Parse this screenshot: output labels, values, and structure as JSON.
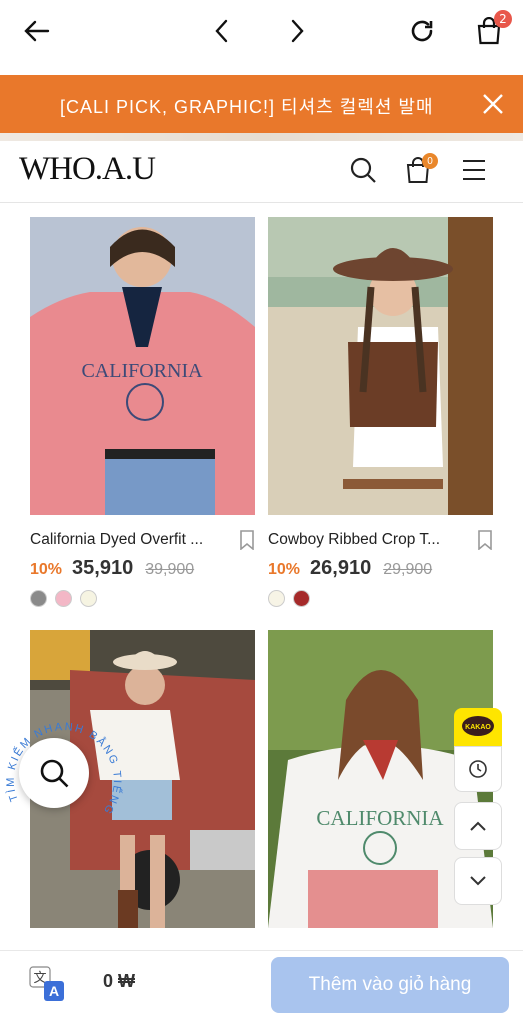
{
  "browser": {
    "cart_count": "2"
  },
  "promo": {
    "text": "[CALI PICK, GRAPHIC!] 티셔츠 컬렉션 발매"
  },
  "header": {
    "logo": "WHO.A.U",
    "cart_count": "0"
  },
  "products": [
    {
      "name": "California Dyed Overfit ...",
      "discount": "10%",
      "price": "35,910",
      "original": "39,900",
      "swatches": [
        "#8a8a8a",
        "#f3b7c6",
        "#f6f4e2"
      ]
    },
    {
      "name": "Cowboy Ribbed Crop T...",
      "discount": "10%",
      "price": "26,910",
      "original": "29,900",
      "swatches": [
        "#f7f4e6",
        "#a52a2a"
      ]
    }
  ],
  "floating": {
    "search_ring_text": "TÌM KIẾM NHANH BẰNG TIẾNG VIỆT",
    "kakao_label": "KAKAO"
  },
  "bottom": {
    "total": "0 ₩",
    "add_to_cart": "Thêm vào giỏ hàng"
  }
}
